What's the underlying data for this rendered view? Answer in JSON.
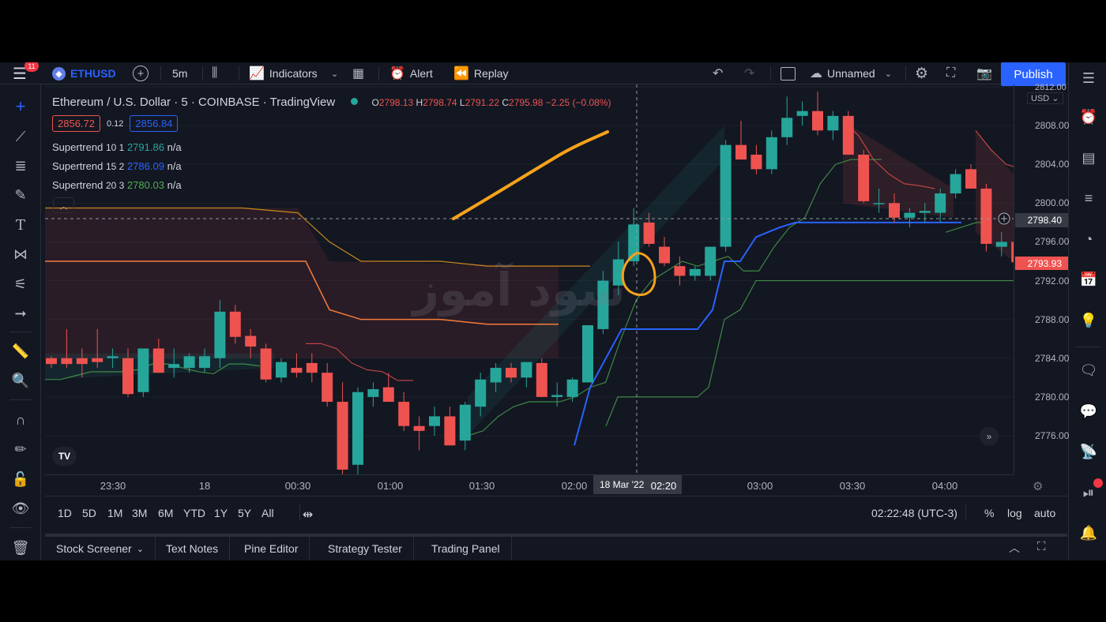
{
  "topbar": {
    "notification_count": "11",
    "symbol": "ETHUSD",
    "interval": "5m",
    "indicators_label": "Indicators",
    "alert_label": "Alert",
    "replay_label": "Replay",
    "layout_name": "Unnamed",
    "publish_label": "Publish"
  },
  "legend": {
    "title": "Ethereum / U.S. Dollar · 5 · COINBASE · TradingView",
    "ohlc": {
      "o_label": "O",
      "o": "2798.13",
      "h_label": "H",
      "h": "2798.74",
      "l_label": "L",
      "l": "2791.22",
      "c_label": "C",
      "c": "2795.98",
      "change": "−2.25 (−0.08%)"
    },
    "sell_price": "2856.72",
    "spread": "0.12",
    "buy_price": "2856.84",
    "indicators": [
      {
        "name": "Supertrend",
        "params": "10 1",
        "value": "2791.86",
        "extra": "n/a",
        "color": "#26a69a"
      },
      {
        "name": "Supertrend",
        "params": "15 2",
        "value": "2786.09",
        "extra": "n/a",
        "color": "#2962ff"
      },
      {
        "name": "Supertrend",
        "params": "20 3",
        "value": "2780.03",
        "extra": "n/a",
        "color": "#4caf50"
      }
    ]
  },
  "price_scale": {
    "currency": "USD",
    "ticks": [
      "2812.00",
      "2808.00",
      "2804.00",
      "2800.00",
      "2796.00",
      "2792.00",
      "2788.00",
      "2784.00",
      "2780.00",
      "2776.00"
    ],
    "crosshair_price": "2798.40",
    "last_price": "2793.93"
  },
  "time_axis": {
    "ticks": [
      "23:30",
      "18",
      "00:30",
      "01:00",
      "01:30",
      "02:00",
      "02:20",
      "03:00",
      "03:30",
      "04:00"
    ],
    "crosshair_label": "18 Mar '22"
  },
  "range_bar": {
    "ranges": [
      "1D",
      "5D",
      "1M",
      "3M",
      "6M",
      "YTD",
      "1Y",
      "5Y",
      "All"
    ],
    "clock": "02:22:48 (UTC-3)",
    "percent_label": "%",
    "log_label": "log",
    "auto_label": "auto"
  },
  "bottom_tabs": [
    "Stock Screener",
    "Text Notes",
    "Pine Editor",
    "Strategy Tester",
    "Trading Panel"
  ],
  "watermark": "سود آموز",
  "colors": {
    "up": "#26a69a",
    "down": "#ef5350",
    "background": "#131722",
    "accent": "#2962ff",
    "annotation": "#f7a21b",
    "st_orange": "#f7a21b"
  },
  "chart_data": {
    "type": "candlestick",
    "ylim": [
      2774.0,
      2813.0
    ],
    "candles": [
      [
        2784.0,
        2784.2,
        2783.0,
        2783.4
      ],
      [
        2784.0,
        2787.0,
        2783.0,
        2783.4
      ],
      [
        2784.0,
        2785.0,
        2782.0,
        2783.4
      ],
      [
        2784.0,
        2787.0,
        2783.0,
        2783.6
      ],
      [
        2784.0,
        2785.0,
        2783.0,
        2784.2
      ],
      [
        2784.0,
        2785.0,
        2780.0,
        2780.3
      ],
      [
        2780.5,
        2785.0,
        2780.0,
        2785.0
      ],
      [
        2785.0,
        2786.0,
        2782.5,
        2782.5
      ],
      [
        2783.0,
        2785.0,
        2782.0,
        2783.4
      ],
      [
        2783.0,
        2784.5,
        2782.5,
        2784.2
      ],
      [
        2783.0,
        2785.0,
        2782.5,
        2784.2
      ],
      [
        2784.0,
        2790.0,
        2783.0,
        2788.8
      ],
      [
        2788.8,
        2789.5,
        2785.5,
        2786.2
      ],
      [
        2786.3,
        2787.0,
        2784.0,
        2785.2
      ],
      [
        2785.0,
        2785.5,
        2781.5,
        2781.8
      ],
      [
        2782.0,
        2784.0,
        2781.5,
        2783.6
      ],
      [
        2783.0,
        2784.5,
        2782.0,
        2782.5
      ],
      [
        2783.5,
        2784.5,
        2781.5,
        2782.5
      ],
      [
        2782.5,
        2783.5,
        2779.0,
        2779.5
      ],
      [
        2779.5,
        2781.5,
        2772.0,
        2772.5
      ],
      [
        2773.0,
        2781.0,
        2772.0,
        2780.5
      ],
      [
        2780.0,
        2781.5,
        2779.0,
        2780.8
      ],
      [
        2781.0,
        2782.5,
        2779.5,
        2779.5
      ],
      [
        2779.5,
        2780.5,
        2776.5,
        2777.0
      ],
      [
        2777.0,
        2778.0,
        2774.5,
        2776.5
      ],
      [
        2777.0,
        2779.0,
        2776.0,
        2778.0
      ],
      [
        2778.0,
        2779.0,
        2775.0,
        2775.0
      ],
      [
        2775.5,
        2779.5,
        2774.5,
        2779.2
      ],
      [
        2779.0,
        2782.5,
        2778.0,
        2781.8
      ],
      [
        2781.5,
        2783.5,
        2780.5,
        2783.0
      ],
      [
        2783.0,
        2783.5,
        2781.5,
        2782.0
      ],
      [
        2782.0,
        2783.5,
        2781.0,
        2783.6
      ],
      [
        2783.5,
        2784.0,
        2780.0,
        2780.0
      ],
      [
        2780.0,
        2781.5,
        2779.0,
        2780.2
      ],
      [
        2780.0,
        2782.0,
        2779.5,
        2781.8
      ],
      [
        2781.5,
        2787.0,
        2781.5,
        2787.4
      ],
      [
        2787.0,
        2793.0,
        2786.5,
        2792.0
      ],
      [
        2791.5,
        2796.0,
        2790.5,
        2794.2
      ],
      [
        2794.0,
        2799.5,
        2793.5,
        2797.8
      ],
      [
        2798.0,
        2799.0,
        2795.5,
        2795.8
      ],
      [
        2795.5,
        2796.5,
        2793.5,
        2793.8
      ],
      [
        2793.5,
        2794.5,
        2791.5,
        2792.5
      ],
      [
        2792.5,
        2793.5,
        2792.0,
        2793.2
      ],
      [
        2792.5,
        2795.5,
        2792.0,
        2795.5
      ],
      [
        2795.5,
        2806.5,
        2795.0,
        2806.0
      ],
      [
        2806.0,
        2808.5,
        2804.5,
        2804.5
      ],
      [
        2805.0,
        2806.0,
        2803.0,
        2803.5
      ],
      [
        2803.5,
        2807.5,
        2803.0,
        2806.8
      ],
      [
        2806.8,
        2811.0,
        2806.0,
        2808.8
      ],
      [
        2809.0,
        2810.5,
        2808.0,
        2809.5
      ],
      [
        2809.5,
        2811.5,
        2807.0,
        2807.5
      ],
      [
        2807.5,
        2809.5,
        2806.5,
        2809.0
      ],
      [
        2809.0,
        2809.5,
        2805.0,
        2805.0
      ],
      [
        2805.0,
        2805.5,
        2800.0,
        2800.2
      ],
      [
        2800.0,
        2801.5,
        2799.0,
        2800.0
      ],
      [
        2800.0,
        2801.0,
        2798.0,
        2798.5
      ],
      [
        2798.5,
        2799.5,
        2797.5,
        2799.0
      ],
      [
        2799.0,
        2800.0,
        2798.0,
        2799.2
      ],
      [
        2799.0,
        2801.5,
        2798.0,
        2801.0
      ],
      [
        2801.0,
        2803.5,
        2800.5,
        2803.0
      ],
      [
        2803.5,
        2804.0,
        2801.5,
        2801.5
      ],
      [
        2801.5,
        2802.0,
        2795.0,
        2795.8
      ],
      [
        2795.5,
        2797.0,
        2794.5,
        2796.0
      ],
      [
        2796.0,
        2796.5,
        2791.5,
        2793.9
      ]
    ],
    "supertrend_10_1": [
      {
        "segment": "up",
        "y": [
          2781.8,
          2781.8,
          2782.2,
          2782.6,
          2782.6,
          2782.6,
          2782.8,
          2783.4,
          2783.4,
          2783.0,
          2782.6,
          2782.4,
          2783.4,
          2783.4,
          2783.2
        ]
      },
      {
        "segment": "down",
        "y": [
          2785.5,
          2785.5,
          2785.0,
          2783.5,
          2782.8,
          2782.6,
          2781.7,
          2781.7
        ]
      },
      {
        "segment": "up",
        "y": [
          2776.0,
          2776.5,
          2778.0,
          2779.0,
          2779.5,
          2779.5,
          2779.5,
          2780.0,
          2781.0,
          2781.5,
          2786.0,
          2790.0,
          2792.0,
          2793.0,
          2794.0,
          2793.5,
          2794.0,
          2794.5,
          2793.0,
          2793.0,
          2795.5,
          2797.5,
          2798.5,
          2802.0,
          2804.0,
          2804.5,
          2804.5,
          2804.5
        ]
      },
      {
        "segment": "down",
        "y": [
          2808.5,
          2807.0,
          2804.5,
          2803.0,
          2802.0,
          2801.8,
          2801.5
        ]
      },
      {
        "segment": "up",
        "y": [
          2797.0,
          2797.5,
          2798.0,
          2798.0
        ]
      },
      {
        "segment": "down",
        "y": [
          2807.5,
          2805.5,
          2804.0,
          2803.5,
          2803.0
        ]
      }
    ],
    "supertrend_15_2": [
      2775.0,
      2781.0,
      2787.0,
      2787.0,
      2787.0,
      2787.0,
      2787.0,
      2789.0,
      2794.0,
      2794.0,
      2796.5,
      2797.5,
      2798.0,
      2798.0,
      2798.0,
      2798.0,
      2798.0,
      2798.0,
      2798.0,
      2798.0,
      2798.0
    ],
    "supertrend_20_3": [
      2777.0,
      2780.0,
      2780.0,
      2780.0,
      2780.0,
      2781.0,
      2788.0,
      2789.0,
      2792.0,
      2792.0,
      2792.0,
      2792.0,
      2792.0,
      2792.0,
      2792.0,
      2792.0,
      2792.0,
      2792.0,
      2792.0,
      2792.0
    ],
    "supertrend_orange": [
      2799.5,
      2799.5,
      2799.5,
      2799.0,
      2796.0,
      2794.0,
      2794.0,
      2794.0,
      2793.5,
      2793.5,
      2793.5,
      2793.5
    ],
    "supertrend_orange_2": [
      2794.0,
      2794.0,
      2794.0,
      2794.0,
      2789.0,
      2788.0,
      2788.0,
      2788.0,
      2787.5,
      2787.5,
      2787.5,
      2787.5
    ]
  }
}
